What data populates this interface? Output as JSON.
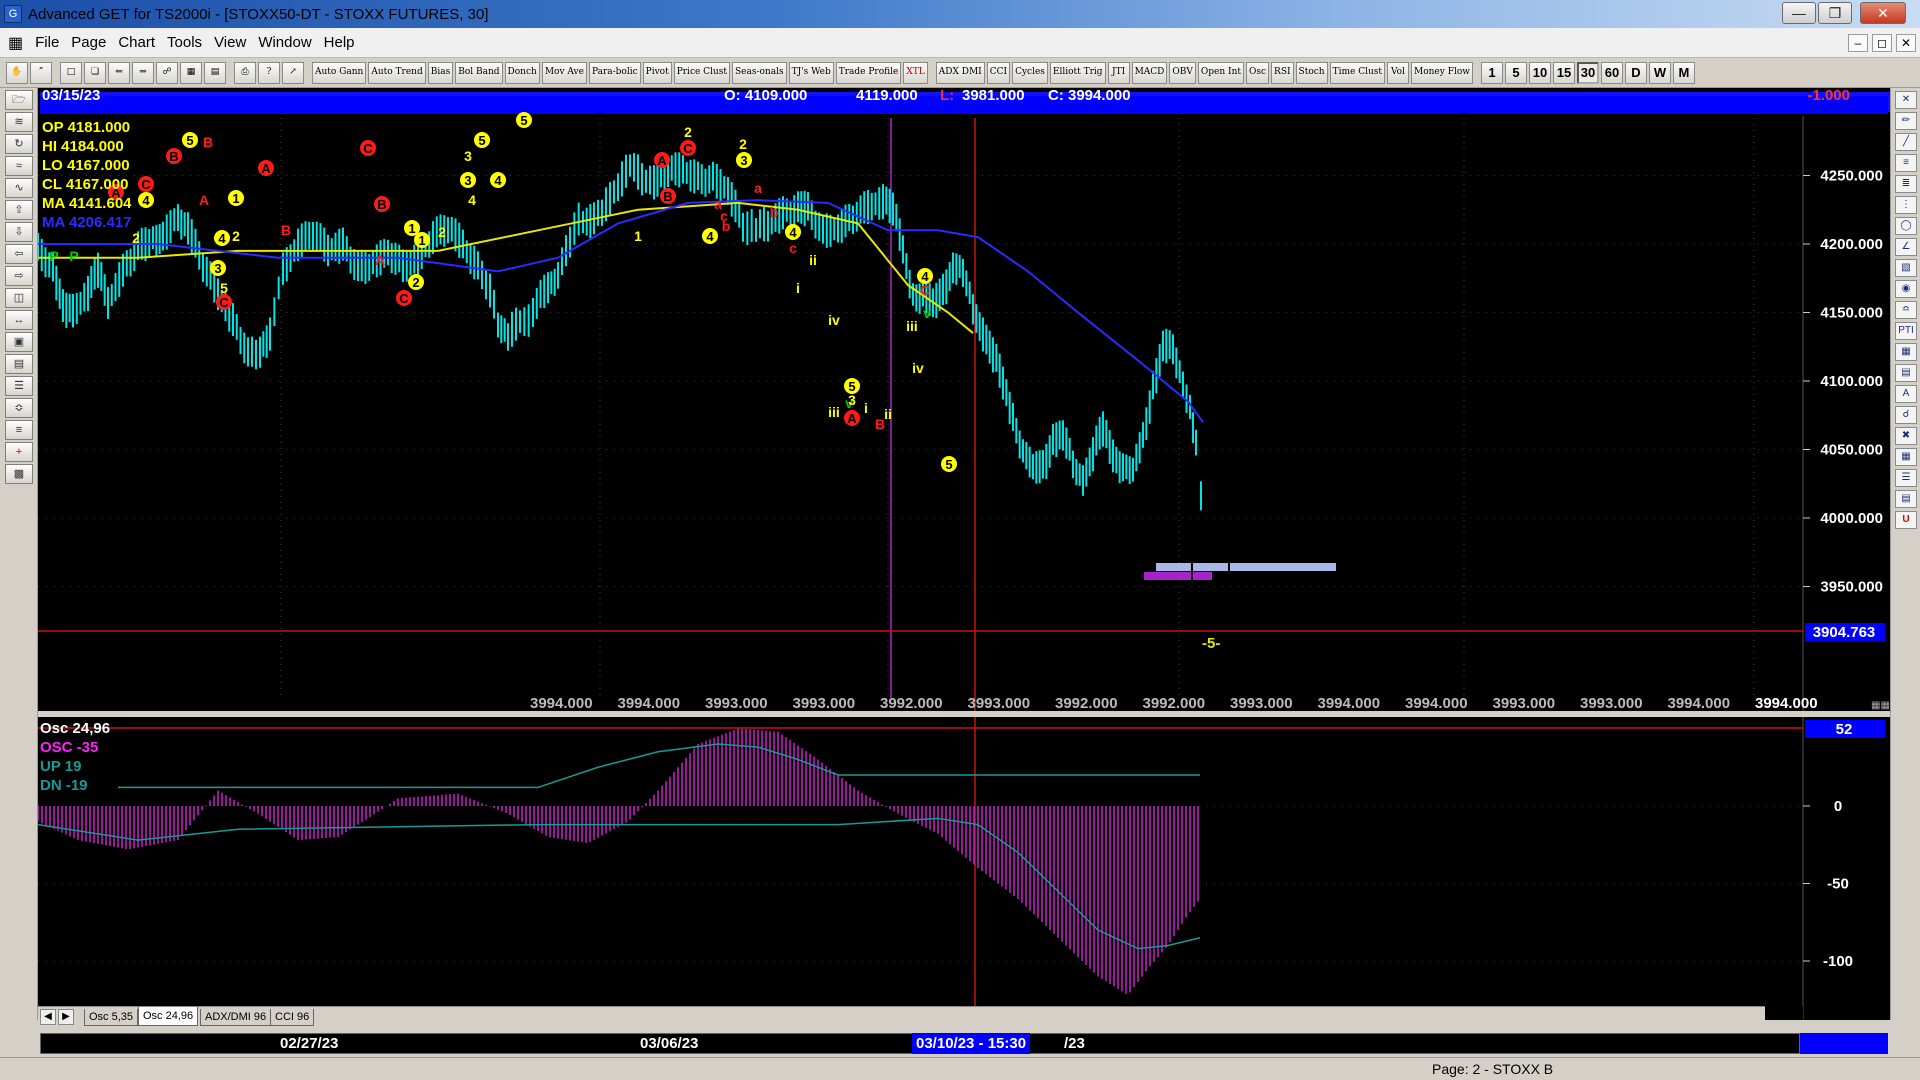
{
  "window": {
    "title": "Advanced GET for TS2000i - [STOXX50-DT - STOXX FUTURES, 30]"
  },
  "menu": [
    "File",
    "Page",
    "Chart",
    "Tools",
    "View",
    "Window",
    "Help"
  ],
  "toolbar": {
    "indicators": [
      "Auto Gann",
      "Auto Trend",
      "Bias",
      "Bol Band",
      "Donch",
      "Mov Ave",
      "Para-bolic",
      "Pivot",
      "Price Clust",
      "Seas-onals",
      "TJ's Web",
      "Trade Profile",
      "XTL",
      "ADX DMI",
      "CCI",
      "Cycles",
      "Elliott Trig",
      "JTI",
      "MACD",
      "OBV",
      "Open Int",
      "Osc",
      "RSI",
      "Stoch",
      "Time Clust",
      "Vol",
      "Money Flow"
    ],
    "periods": [
      "1",
      "5",
      "10",
      "15",
      "30",
      "60",
      "D",
      "W",
      "M"
    ],
    "active_period": "30"
  },
  "chart": {
    "header": {
      "date": "03/15/23",
      "open": "O: 4109.000",
      "high": "4119.000",
      "low_label": "L:",
      "low": "3981.000",
      "close": "C: 3994.000",
      "change": "-1.000"
    },
    "info": {
      "op": "OP  4181.000",
      "hi": "HI   4184.000",
      "lo": "LO  4167.000",
      "cl": "CL  4167.000",
      "ma1": "MA  4141.604",
      "ma2": "MA  4206.417"
    },
    "price_ticks": [
      "4250.000",
      "4200.000",
      "4150.000",
      "4100.000",
      "4050.000",
      "4000.000",
      "3950.000"
    ],
    "current_price": "3904.763",
    "projection_label": "-5-",
    "bottom_values": [
      "3994.000",
      "3994.000",
      "3993.000",
      "3993.000",
      "3992.000",
      "3993.000",
      "3992.000",
      "3992.000",
      "3993.000",
      "3994.000",
      "3994.000",
      "3993.000",
      "3993.000",
      "3994.000",
      "3994.000"
    ],
    "date_labels": [
      "02/27/23",
      "03/06/23"
    ],
    "cursor_date": "03/10/23 - 15:30",
    "cursor_date_tail": "/23",
    "colors": {
      "yellow": "#ffff00",
      "red": "#ff0000",
      "blue": "#1c1cff",
      "green": "#00c800",
      "purple": "#ff00ff",
      "teal": "#1a9a96",
      "magenta": "#d01cd0",
      "cyan": "#00ffff"
    }
  },
  "waves": [
    {
      "t": "5",
      "c": "y"
    },
    {
      "t": "B",
      "c": "r"
    },
    {
      "t": "B",
      "c": "r"
    },
    {
      "t": "C",
      "c": "r"
    },
    {
      "t": "4",
      "c": "y"
    },
    {
      "t": "A",
      "c": "r"
    },
    {
      "t": "A",
      "c": "r"
    },
    {
      "t": "1",
      "c": "y"
    },
    {
      "t": "2",
      "c": "y"
    },
    {
      "t": "P",
      "c": "g"
    },
    {
      "t": "P",
      "c": "g"
    },
    {
      "t": "2",
      "c": "y"
    },
    {
      "t": "4",
      "c": "y"
    },
    {
      "t": "3",
      "c": "y"
    },
    {
      "t": "5",
      "c": "y"
    },
    {
      "t": "C",
      "c": "r"
    },
    {
      "t": "A",
      "c": "r"
    },
    {
      "t": "B",
      "c": "r"
    },
    {
      "t": "C",
      "c": "r"
    },
    {
      "t": "B",
      "c": "r"
    },
    {
      "t": "A",
      "c": "r"
    },
    {
      "t": "1",
      "c": "y"
    },
    {
      "t": "1",
      "c": "y"
    },
    {
      "t": "2",
      "c": "y"
    },
    {
      "t": "C",
      "c": "r"
    },
    {
      "t": "2",
      "c": "y"
    },
    {
      "t": "3",
      "c": "y"
    },
    {
      "t": "5",
      "c": "y"
    },
    {
      "t": "3",
      "c": "y"
    },
    {
      "t": "4",
      "c": "y"
    },
    {
      "t": "4",
      "c": "y"
    },
    {
      "t": "5",
      "c": "y"
    },
    {
      "t": "1",
      "c": "y"
    },
    {
      "t": "A",
      "c": "r"
    },
    {
      "t": "B",
      "c": "r"
    },
    {
      "t": "2",
      "c": "y"
    },
    {
      "t": "C",
      "c": "r"
    },
    {
      "t": "a",
      "c": "r"
    },
    {
      "t": "b",
      "c": "r"
    },
    {
      "t": "4",
      "c": "y"
    },
    {
      "t": "c",
      "c": "r"
    },
    {
      "t": "2",
      "c": "y"
    },
    {
      "t": "3",
      "c": "y"
    },
    {
      "t": "a",
      "c": "r"
    },
    {
      "t": "b",
      "c": "r"
    },
    {
      "t": "4",
      "c": "y"
    },
    {
      "t": "c",
      "c": "r"
    },
    {
      "t": "ii",
      "c": "y"
    },
    {
      "t": "i",
      "c": "y"
    },
    {
      "t": "iv",
      "c": "y"
    },
    {
      "t": "iii",
      "c": "y"
    },
    {
      "t": "v",
      "c": "g"
    },
    {
      "t": "5",
      "c": "y"
    },
    {
      "t": "3",
      "c": "y"
    },
    {
      "t": "A",
      "c": "r"
    },
    {
      "t": "i",
      "c": "y"
    },
    {
      "t": "B",
      "c": "r"
    },
    {
      "t": "ii",
      "c": "y"
    },
    {
      "t": "4",
      "c": "y"
    },
    {
      "t": "C",
      "c": "r"
    },
    {
      "t": "iii",
      "c": "y"
    },
    {
      "t": "v",
      "c": "g"
    },
    {
      "t": "iv",
      "c": "y"
    },
    {
      "t": "5",
      "c": "y"
    }
  ],
  "osc": {
    "title": "Osc 24,96",
    "osc": "OSC -35",
    "up": "UP   19",
    "dn": "DN   -19",
    "value": "52",
    "ticks": [
      "0",
      "-50",
      "-100"
    ]
  },
  "tabs": [
    "Osc 5,35",
    "Osc 24,96",
    "ADX/DMI 96",
    "CCI 96"
  ],
  "status": {
    "page": "Page: 2 - STOXX B"
  }
}
